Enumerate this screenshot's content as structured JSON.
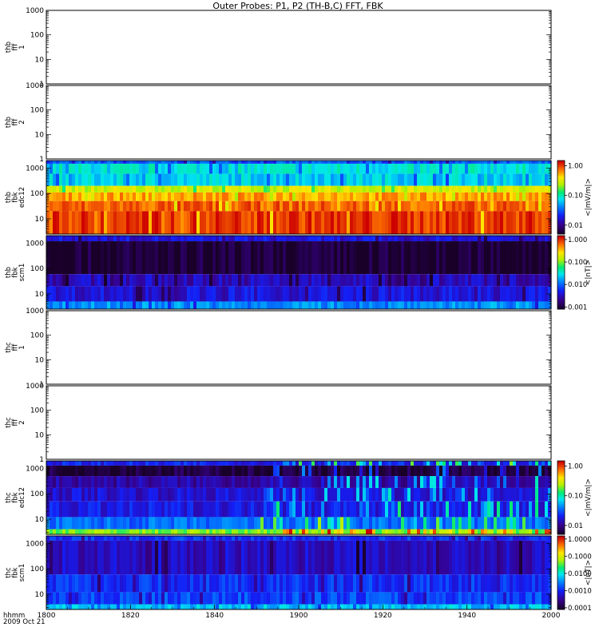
{
  "title": "Outer Probes: P1, P2 (TH-B,C) FFT, FBK",
  "chart_data": {
    "type": "heatmap",
    "title": "Outer Probes: P1, P2 (TH-B,C) FFT, FBK",
    "x_axis": {
      "label_lines": [
        "hhmm",
        "2009 Oct 21"
      ],
      "ticks": [
        "1800",
        "1820",
        "1840",
        "1900",
        "1920",
        "1940",
        "2000"
      ],
      "range": [
        "1800",
        "2000"
      ]
    },
    "panels": [
      {
        "id": "thb-fff-1",
        "ylabel_lines": [
          "thb",
          "fff",
          "1"
        ],
        "yscale": "log",
        "ylim": [
          1,
          1000
        ],
        "yticks": [
          "1",
          "10",
          "100",
          "1000"
        ],
        "empty": true
      },
      {
        "id": "thb-fff-2",
        "ylabel_lines": [
          "thb",
          "fff",
          "2"
        ],
        "yscale": "log",
        "ylim": [
          1,
          1000
        ],
        "yticks": [
          "1",
          "10",
          "100",
          "1000"
        ],
        "empty": true
      },
      {
        "id": "thb-fbk-edc12",
        "ylabel_lines": [
          "thb",
          "fbk",
          "edc12"
        ],
        "yscale": "log",
        "ylim": [
          2.5,
          2000
        ],
        "yticks": [
          "10",
          "100",
          "1000"
        ],
        "empty": false,
        "colorbar": {
          "label": "<|mV/m|>",
          "scale": "log",
          "ticks": [
            "0.01",
            "0.10",
            "1.00"
          ],
          "range": [
            0.005,
            1.5
          ]
        },
        "bands": [
          {
            "freq_low": 1500,
            "freq_high": 2000,
            "level": 0.03
          },
          {
            "freq_low": 600,
            "freq_high": 1500,
            "level": 0.08
          },
          {
            "freq_low": 200,
            "freq_high": 600,
            "level": 0.07
          },
          {
            "freq_low": 110,
            "freq_high": 200,
            "level": 0.3
          },
          {
            "freq_low": 50,
            "freq_high": 110,
            "level": 0.6
          },
          {
            "freq_low": 20,
            "freq_high": 50,
            "level": 0.85
          },
          {
            "freq_low": 2.5,
            "freq_high": 20,
            "level": 1.1
          }
        ]
      },
      {
        "id": "thb-fbk-scm1",
        "ylabel_lines": [
          "thb",
          "fbk",
          "scm1"
        ],
        "yscale": "log",
        "ylim": [
          2.5,
          2000
        ],
        "yticks": [
          "10",
          "100",
          "1000"
        ],
        "empty": false,
        "colorbar": {
          "label": "<|nT|>",
          "scale": "log",
          "ticks": [
            "0.001",
            "0.010",
            "0.100",
            "1.000"
          ],
          "range": [
            0.0008,
            1.5
          ]
        },
        "bands": [
          {
            "freq_low": 1200,
            "freq_high": 2000,
            "level": 0.004
          },
          {
            "freq_low": 60,
            "freq_high": 1200,
            "level": 0.0009
          },
          {
            "freq_low": 20,
            "freq_high": 60,
            "level": 0.003
          },
          {
            "freq_low": 5,
            "freq_high": 20,
            "level": 0.004
          },
          {
            "freq_low": 2.5,
            "freq_high": 5,
            "level": 0.015
          }
        ]
      },
      {
        "id": "thc-fff-1",
        "ylabel_lines": [
          "thc",
          "fff",
          "1"
        ],
        "yscale": "log",
        "ylim": [
          1,
          1000
        ],
        "yticks": [
          "1",
          "10",
          "100",
          "1000"
        ],
        "empty": true
      },
      {
        "id": "thc-fff-2",
        "ylabel_lines": [
          "thc",
          "fff",
          "2"
        ],
        "yscale": "log",
        "ylim": [
          1,
          1000
        ],
        "yticks": [
          "1",
          "10",
          "100",
          "1000"
        ],
        "empty": true
      },
      {
        "id": "thc-fbk-edc12",
        "ylabel_lines": [
          "thc",
          "fbk",
          "edc12"
        ],
        "yscale": "log",
        "ylim": [
          2.5,
          2000
        ],
        "yticks": [
          "10",
          "100",
          "1000"
        ],
        "empty": false,
        "colorbar": {
          "label": "<|mV/m|>",
          "scale": "log",
          "ticks": [
            "0.01",
            "0.10",
            "1.00"
          ],
          "range": [
            0.005,
            1.5
          ]
        },
        "bands": [
          {
            "freq_low": 1300,
            "freq_high": 2000,
            "level": 0.02
          },
          {
            "freq_low": 500,
            "freq_high": 1300,
            "level": 0.006
          },
          {
            "freq_low": 170,
            "freq_high": 500,
            "level": 0.012
          },
          {
            "freq_low": 50,
            "freq_high": 170,
            "level": 0.016
          },
          {
            "freq_low": 12,
            "freq_high": 50,
            "level": 0.018
          },
          {
            "freq_low": 4,
            "freq_high": 12,
            "level": 0.035
          },
          {
            "freq_low": 2.5,
            "freq_high": 4,
            "level": 0.2
          }
        ]
      },
      {
        "id": "thc-fbk-scm1",
        "ylabel_lines": [
          "thc",
          "fbk",
          "scm1"
        ],
        "yscale": "log",
        "ylim": [
          2.5,
          2000
        ],
        "yticks": [
          "10",
          "100",
          "1000"
        ],
        "empty": false,
        "colorbar": {
          "label": "<|nT|>",
          "scale": "log",
          "ticks": [
            "0.0001",
            "0.0010",
            "0.0100",
            "0.1000",
            "1.0000"
          ],
          "range": [
            8e-05,
            1.5
          ]
        },
        "bands": [
          {
            "freq_low": 1300,
            "freq_high": 2000,
            "level": 0.0011
          },
          {
            "freq_low": 60,
            "freq_high": 1300,
            "level": 0.0005
          },
          {
            "freq_low": 12,
            "freq_high": 60,
            "level": 0.0011
          },
          {
            "freq_low": 4,
            "freq_high": 12,
            "level": 0.0015
          },
          {
            "freq_low": 2.5,
            "freq_high": 4,
            "level": 0.006
          }
        ]
      }
    ]
  }
}
